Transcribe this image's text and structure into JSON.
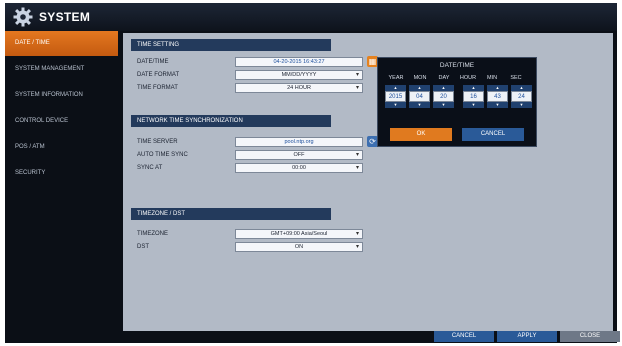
{
  "window": {
    "title": "SYSTEM"
  },
  "sidebar": {
    "items": [
      {
        "label": "DATE / TIME",
        "active": true
      },
      {
        "label": "SYSTEM MANAGEMENT"
      },
      {
        "label": "SYSTEM INFORMATION"
      },
      {
        "label": "CONTROL DEVICE"
      },
      {
        "label": "POS / ATM"
      },
      {
        "label": "SECURITY"
      }
    ]
  },
  "time_setting": {
    "header": "TIME SETTING",
    "date_time_label": "DATE/TIME",
    "date_time_value": "04-20-2015 16:43:27",
    "date_format_label": "DATE FORMAT",
    "date_format_value": "MM/DD/YYYY",
    "time_format_label": "TIME FORMAT",
    "time_format_value": "24 HOUR"
  },
  "network_sync": {
    "header": "NETWORK TIME SYNCHRONIZATION",
    "time_server_label": "TIME SERVER",
    "time_server_value": "pool.ntp.org",
    "auto_sync_label": "AUTO TIME SYNC",
    "auto_sync_value": "OFF",
    "sync_at_label": "SYNC AT",
    "sync_at_value": "00:00"
  },
  "timezone": {
    "header": "TIMEZONE / DST",
    "timezone_label": "TIMEZONE",
    "timezone_value": "GMT+09:00 Asia/Seoul",
    "dst_label": "DST",
    "dst_value": "ON"
  },
  "popup": {
    "title": "DATE/TIME",
    "labels": {
      "year": "YEAR",
      "mon": "MON",
      "day": "DAY",
      "hour": "HOUR",
      "min": "MIN",
      "sec": "SEC"
    },
    "values": {
      "year": "2015",
      "mon": "04",
      "day": "20",
      "hour": "16",
      "min": "43",
      "sec": "24"
    },
    "ok_label": "OK",
    "cancel_label": "CANCEL"
  },
  "footer": {
    "cancel_label": "CANCEL",
    "apply_label": "APPLY",
    "close_label": "CLOSE"
  },
  "colors": {
    "accent": "#e47820",
    "header_bg": "#233a5c",
    "panel_bg": "#b2bac6",
    "button_blue": "#2a5a98"
  },
  "icons": [
    "gear-icon",
    "calendar-icon",
    "sync-icon"
  ]
}
